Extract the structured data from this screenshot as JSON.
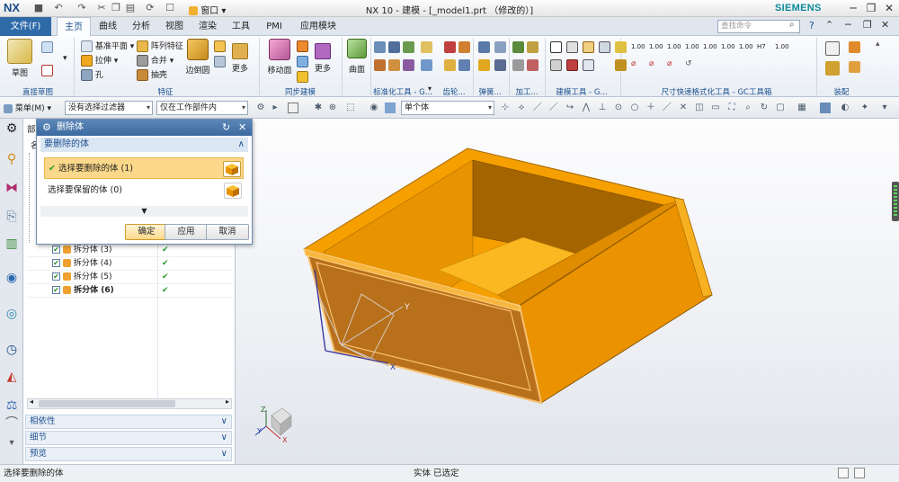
{
  "titlebar": {
    "logo": "NX",
    "window_label": "窗口",
    "title": "NX 10 - 建模 - [_model1.prt （修改的）]",
    "brand": "SIEMENS"
  },
  "menu": {
    "file": "文件(F)",
    "tabs": [
      "主页",
      "曲线",
      "分析",
      "视图",
      "渲染",
      "工具",
      "PMI",
      "应用模块"
    ],
    "search_placeholder": "查找命令"
  },
  "ribbon": {
    "sketch": "草图",
    "datum_plane": "基准平面",
    "extrude": "拉伸",
    "hole": "孔",
    "pattern_feature": "阵列特征",
    "unite": "合并",
    "shell": "抽壳",
    "edge_blend": "边倒圆",
    "more1": "更多",
    "move_face": "移动面",
    "more2": "更多",
    "surface": "曲面",
    "more3": "更多",
    "groups": {
      "direct_sketch": "直接草图",
      "feature": "特征",
      "sync_modeling": "同步建模",
      "std_tools": "标准化工具 - G...",
      "gear": "齿轮...",
      "spring": "弹簧...",
      "machining": "加工...",
      "modeling_tools": "建模工具 - G...",
      "dim_tools": "尺寸快速格式化工具 - GC工具箱",
      "assembly": "装配"
    }
  },
  "selbar": {
    "menu": "菜单(M)",
    "filter": "没有选择过滤器",
    "scope": "仅在工作部件内",
    "body": "单个体"
  },
  "navigator": {
    "header_part": "部",
    "col_name": "名",
    "items": [
      {
        "label": "拆分体 (3)",
        "bold": false
      },
      {
        "label": "拆分体 (4)",
        "bold": false
      },
      {
        "label": "拆分体 (5)",
        "bold": false
      },
      {
        "label": "拆分体 (6)",
        "bold": true
      }
    ],
    "sections": [
      "相依性",
      "细节",
      "预览"
    ]
  },
  "dialog": {
    "title": "删除体",
    "section": "要删除的体",
    "row_delete": "选择要删除的体 (1)",
    "row_keep": "选择要保留的体 (0)",
    "ok": "确定",
    "apply": "应用",
    "cancel": "取消"
  },
  "status": {
    "left": "选择要删除的体",
    "center": "实体 已选定"
  },
  "colors": {
    "accent": "#2e6aa8",
    "body_orange": "#f5a000",
    "body_dark": "#b86e00",
    "highlight_row": "#fcd88a"
  }
}
